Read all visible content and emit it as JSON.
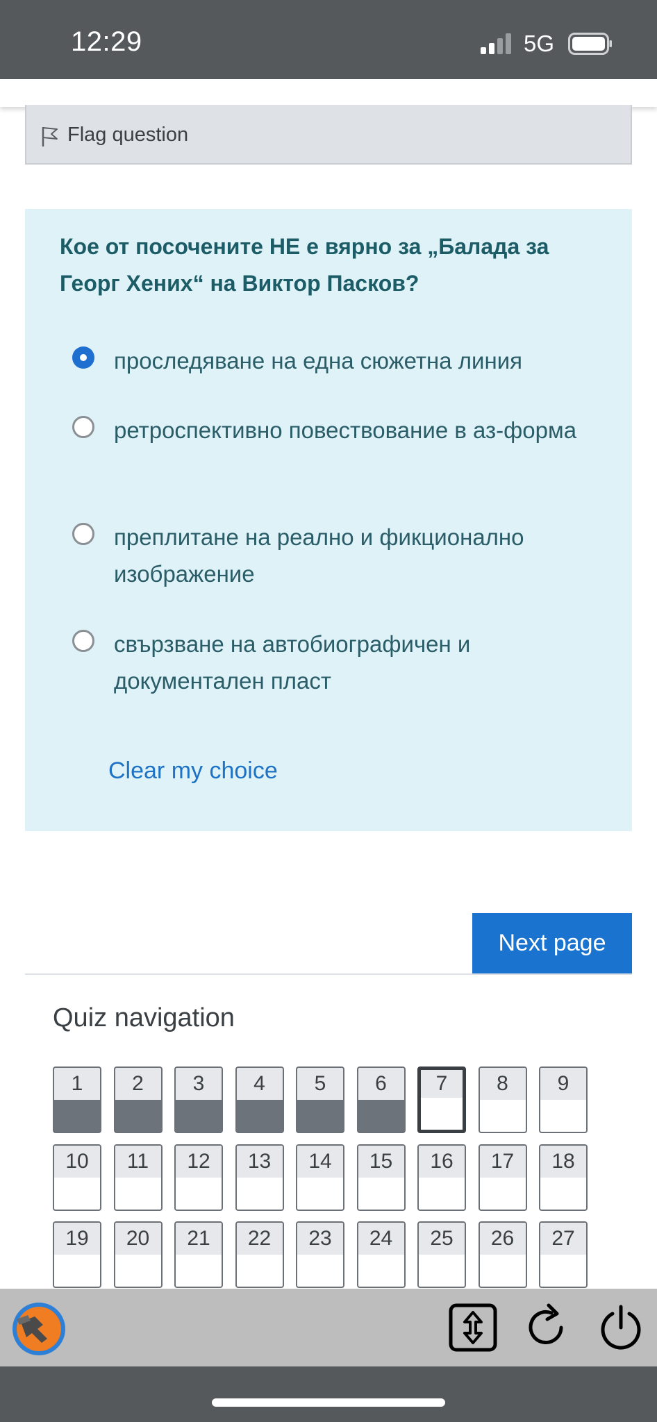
{
  "status_bar": {
    "time": "12:29",
    "network": "5G"
  },
  "flag": {
    "label": "Flag question"
  },
  "question": {
    "text": "Кое от посочените НЕ е вярно за „Балада за Георг Хених“ на Виктор Пасков?",
    "answers": [
      {
        "label": "проследяване на една сюжетна линия",
        "selected": true
      },
      {
        "label": "ретроспективно повествование в аз-форма",
        "selected": false
      },
      {
        "label": "преплитане на реално и фикционално изображение",
        "selected": false
      },
      {
        "label": "свързване на автобиографичен и документален пласт",
        "selected": false
      }
    ],
    "clear_label": "Clear my choice"
  },
  "next_label": "Next page",
  "quiz_nav": {
    "title": "Quiz navigation",
    "buttons": [
      {
        "n": "1",
        "state": "answered"
      },
      {
        "n": "2",
        "state": "answered"
      },
      {
        "n": "3",
        "state": "answered"
      },
      {
        "n": "4",
        "state": "answered"
      },
      {
        "n": "5",
        "state": "answered"
      },
      {
        "n": "6",
        "state": "answered"
      },
      {
        "n": "7",
        "state": "current"
      },
      {
        "n": "8",
        "state": "empty"
      },
      {
        "n": "9",
        "state": "empty"
      },
      {
        "n": "10",
        "state": "empty"
      },
      {
        "n": "11",
        "state": "empty"
      },
      {
        "n": "12",
        "state": "empty"
      },
      {
        "n": "13",
        "state": "empty"
      },
      {
        "n": "14",
        "state": "empty"
      },
      {
        "n": "15",
        "state": "empty"
      },
      {
        "n": "16",
        "state": "empty"
      },
      {
        "n": "17",
        "state": "empty"
      },
      {
        "n": "18",
        "state": "empty"
      },
      {
        "n": "19",
        "state": "empty"
      },
      {
        "n": "20",
        "state": "empty"
      },
      {
        "n": "21",
        "state": "empty"
      },
      {
        "n": "22",
        "state": "empty"
      },
      {
        "n": "23",
        "state": "empty"
      },
      {
        "n": "24",
        "state": "empty"
      },
      {
        "n": "25",
        "state": "empty"
      },
      {
        "n": "26",
        "state": "empty"
      },
      {
        "n": "27",
        "state": "empty"
      }
    ]
  },
  "toolbar": {
    "icons": [
      "app-logo-icon",
      "scroll-toggle-icon",
      "reload-icon",
      "power-icon"
    ]
  },
  "colors": {
    "accent": "#1a73cf",
    "card_bg": "#def2f8",
    "question_text": "#1c5c66"
  }
}
